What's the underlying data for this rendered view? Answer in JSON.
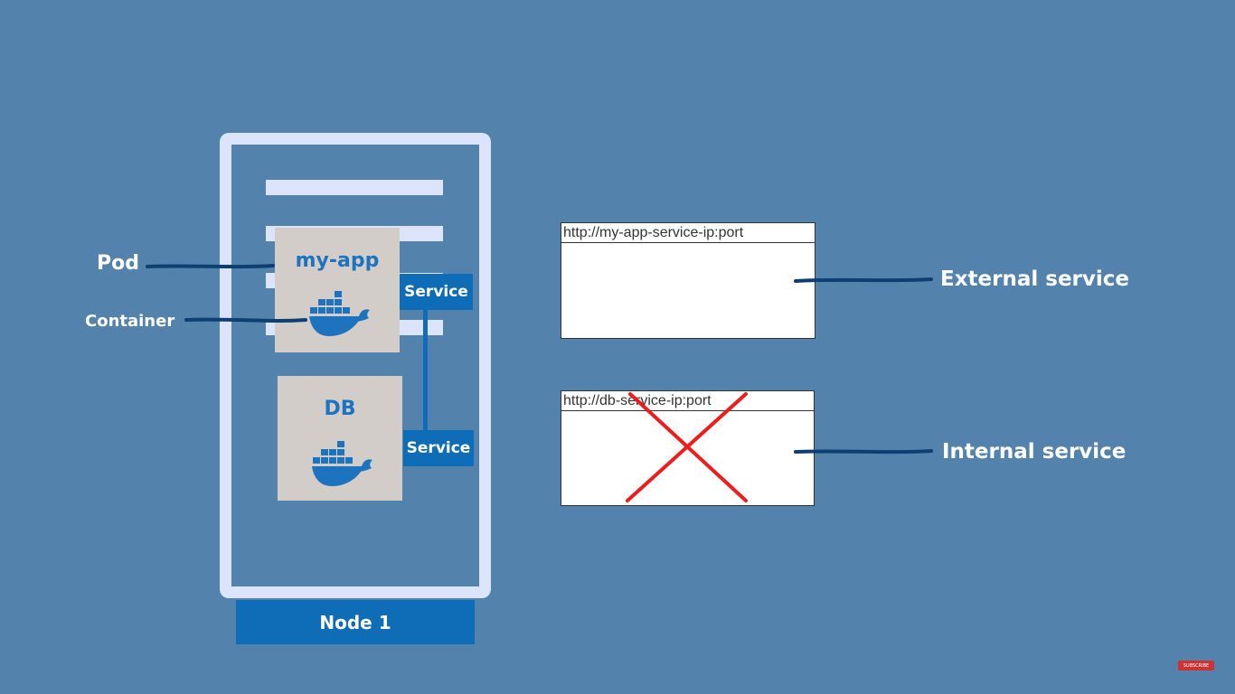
{
  "node": {
    "label": "Node 1"
  },
  "pods": {
    "app": {
      "title": "my-app",
      "service_label": "Service"
    },
    "db": {
      "title": "DB",
      "service_label": "Service"
    }
  },
  "labels": {
    "pod": "Pod",
    "container": "Container",
    "external_service": "External service",
    "internal_service": "Internal service"
  },
  "browsers": {
    "external": {
      "url": "http://my-app-service-ip:port",
      "blocked": false
    },
    "internal": {
      "url": "http://db-service-ip:port",
      "blocked": true
    }
  },
  "badge": {
    "text": "SUBSCRIBE"
  },
  "colors": {
    "background": "#5383ad",
    "node_frame": "#dbe4fb",
    "service_blue": "#0f6db8",
    "pod_gray": "#d3cdca",
    "docker_blue": "#1e73be",
    "blocked_cross": "#ee1c1c",
    "connector": "#0d3f72"
  },
  "icons": {
    "container_icon": "docker-whale-icon",
    "blocked_icon": "red-x-cross-icon"
  }
}
